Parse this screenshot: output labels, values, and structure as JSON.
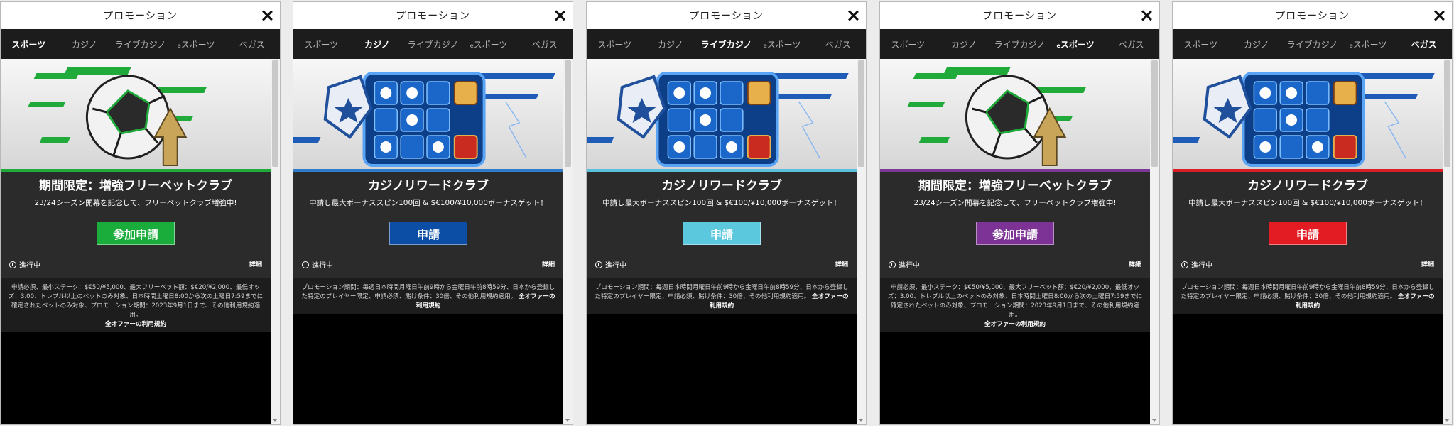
{
  "window": {
    "title": "プロモーション"
  },
  "tabs": [
    {
      "label": "スポーツ"
    },
    {
      "label": "カジノ"
    },
    {
      "label": "ライブカジノ"
    },
    {
      "prefix": "e",
      "label": "スポーツ"
    },
    {
      "label": "ベガス"
    }
  ],
  "promos": {
    "sports": {
      "headline": "期間限定：増強フリーベットクラブ",
      "subtitle": "23/24シーズン開幕を記念して、フリーベットクラブ増強中!",
      "cta": "参加申請",
      "status": "進行中",
      "details": "詳細",
      "terms": "申請必須、最小ステーク：$€50/¥5,000、最大フリーベット額：$€20/¥2,000、最低オッズ：3.00、トレブル以上のベットのみ対象、日本時間土曜日8:00から次の土曜日7:59までに確定されたベットのみ対象、プロモーション期間：2023年9月1日まで、その他利用規約適用。",
      "all_offers": "全オファーの利用規約"
    },
    "casino": {
      "headline": "カジノリワードクラブ",
      "subtitle": "申請し最大ボーナススピン100回 & $€100/¥10,000ボーナスゲット！",
      "cta": "申請",
      "status": "進行中",
      "details": "詳細",
      "terms": "プロモーション期間：毎週日本時間月曜日午前9時から金曜日午前8時59分、日本から登録した特定のプレイヤー限定、申請必須、賭け条件：30倍、その他利用規約適用。",
      "all_offers": "全オファーの利用規約"
    }
  },
  "colors": {
    "sports_cta": "#1aad3c",
    "casino_cta": "#0c4ea6",
    "live_cta": "#5bc8de",
    "esports_cta": "#7d3395",
    "vegas_cta": "#e31b23",
    "sports_accent": "#1faa3a",
    "casino_accent": "#2f7ccd",
    "live_accent": "#59c1de",
    "esports_accent": "#7c3a96",
    "vegas_accent": "#d81f27"
  }
}
